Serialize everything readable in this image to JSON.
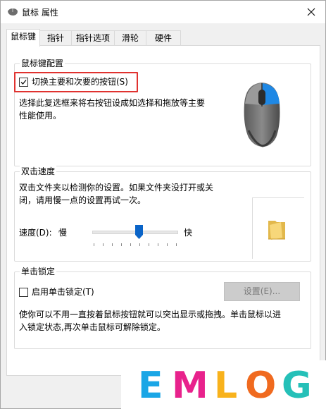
{
  "window": {
    "title": "鼠标 属性"
  },
  "tabs": [
    {
      "label": "鼠标键",
      "active": true
    },
    {
      "label": "指针"
    },
    {
      "label": "指针选项"
    },
    {
      "label": "滑轮"
    },
    {
      "label": "硬件"
    }
  ],
  "button_config": {
    "title": "鼠标键配置",
    "switch_checkbox_label": "切换主要和次要的按钮(S)",
    "switch_checked": true,
    "description_line1": "选择此复选框来将右按钮设成如选择和拖放等主要",
    "description_line2": "性能使用。"
  },
  "double_click": {
    "title": "双击速度",
    "description_line1": "双击文件夹以检测你的设置。如果文件夹没打开或关",
    "description_line2": "闭，请用慢一点的设置再试一次。",
    "speed_label": "速度(D):",
    "slow_label": "慢",
    "fast_label": "快",
    "speed_value_fraction": 0.55
  },
  "click_lock": {
    "title": "单击锁定",
    "checkbox_label": "启用单击锁定(T)",
    "checked": false,
    "settings_button": "设置(E)...",
    "description_line1": "使你可以不用一直按着鼠标按钮就可以突出显示或拖拽。单击鼠标以进",
    "description_line2": "入锁定状态,再次单击鼠标可解除锁定。"
  },
  "watermark": {
    "letters": [
      "E",
      "M",
      "L",
      "O",
      "G"
    ],
    "colors": [
      "#1aa6e6",
      "#e8228c",
      "#f8b21c",
      "#f06a1f",
      "#25c0b8"
    ]
  },
  "icons": {
    "title": "mouse-icon",
    "close": "close-icon",
    "mouse_image": "mouse-image",
    "folder": "folder-icon"
  },
  "colors": {
    "highlight": "#e0322f",
    "mouse_accent": "#1e88e5",
    "slider_thumb": "#0a64c8"
  }
}
